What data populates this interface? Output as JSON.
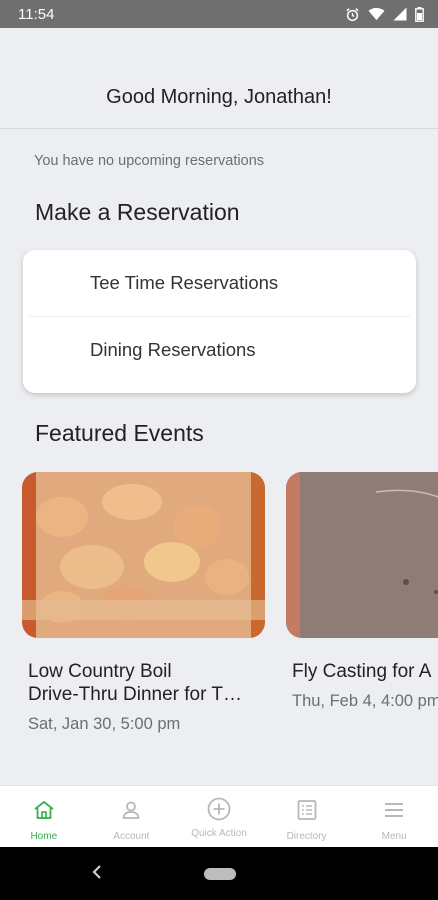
{
  "status": {
    "time": "11:54",
    "icons": [
      "alarm-icon",
      "wifi-icon",
      "signal-icon",
      "battery-icon"
    ]
  },
  "header": {
    "greeting": "Good Morning, Jonathan!"
  },
  "reservations": {
    "notice": "You have no upcoming reservations",
    "title": "Make a Reservation",
    "items": [
      {
        "label": "Tee Time Reservations"
      },
      {
        "label": "Dining Reservations"
      }
    ]
  },
  "events": {
    "title": "Featured Events",
    "cards": [
      {
        "title_line1": "Low Country Boil",
        "title_line2": "Drive-Thru Dinner for T…",
        "date": "Sat, Jan 30, 5:00 pm"
      },
      {
        "title_line1": "Fly Casting for A",
        "date": "Thu, Feb 4, 4:00 pm"
      }
    ]
  },
  "nav": {
    "items": [
      {
        "label": "Home",
        "icon": "home-icon",
        "active": true
      },
      {
        "label": "Account",
        "icon": "account-icon",
        "active": false
      },
      {
        "label": "Quick Action",
        "icon": "plus-circle-icon",
        "active": false
      },
      {
        "label": "Directory",
        "icon": "directory-icon",
        "active": false
      },
      {
        "label": "Menu",
        "icon": "menu-icon",
        "active": false
      }
    ]
  },
  "colors": {
    "accent": "#35b04a",
    "background": "#eceef1",
    "status_bar": "#6f6f6f"
  }
}
